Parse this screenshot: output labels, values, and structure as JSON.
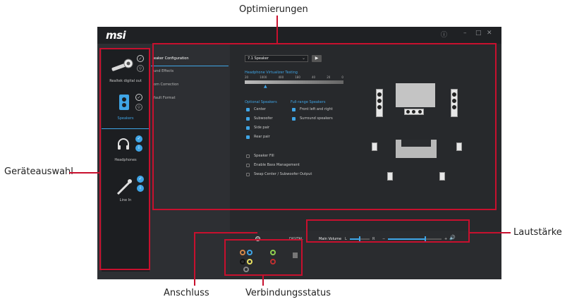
{
  "annotations": {
    "optimierungen": "Optimierungen",
    "geraeteauswahl": "Geräteauswahl",
    "lautstaerke": "Lautstärke",
    "anschluss": "Anschluss",
    "verbindungsstatus": "Verbindungsstatus"
  },
  "app": {
    "logo": "msi",
    "window_controls": [
      "ⓘ",
      "–",
      "□",
      "✕"
    ]
  },
  "devices": [
    {
      "label": "Realtek digital out",
      "selected": false
    },
    {
      "label": "Speakers",
      "selected": true
    },
    {
      "label": "Headphones",
      "selected": false
    },
    {
      "label": "Line In",
      "selected": false
    }
  ],
  "tabs": [
    "Speaker Configuration",
    "Sound Effects",
    "Room Correction",
    "Default Format"
  ],
  "tabs_visible": [
    "eaker Configuration",
    "und Effects",
    "om Correction",
    "fault Format"
  ],
  "config": {
    "speaker_select": "7.1 Speaker",
    "play_button": "▶",
    "section_title": "Headphone Virtualizer Testing",
    "freq_labels": [
      "20",
      "1000",
      "400",
      "180",
      "40",
      "20",
      "0"
    ],
    "optional_title": "Optional Speakers",
    "optional": [
      {
        "label": "Center",
        "checked": true
      },
      {
        "label": "Subwoofer",
        "checked": true
      },
      {
        "label": "Side pair",
        "checked": true
      },
      {
        "label": "Rear pair",
        "checked": true
      }
    ],
    "fullrange_title": "Full-range Speakers",
    "fullrange": [
      {
        "label": "Front left and right",
        "checked": true
      },
      {
        "label": "Surround speakers",
        "checked": true
      }
    ],
    "extra": [
      {
        "label": "Speaker Fill",
        "checked": false
      },
      {
        "label": "Enable Bass Management",
        "checked": false
      },
      {
        "label": "Swap Center / Subwoofer Output",
        "checked": false
      }
    ]
  },
  "bottom": {
    "digital_label": "DIGITAL",
    "main_volume_label": "Main Volume",
    "l_label": "L",
    "r_label": "R",
    "minus": "−",
    "plus": "+",
    "speaker_icon": "🔊",
    "balance": 0.5,
    "volume": 0.7
  },
  "jacks": [
    "#d4884a",
    "#3fa5e6",
    "#90d050",
    "#111111",
    "#e8e060",
    "#c03030",
    "#888888"
  ],
  "colors": {
    "accent": "#3fa5e6",
    "annotation": "#c8102e"
  }
}
